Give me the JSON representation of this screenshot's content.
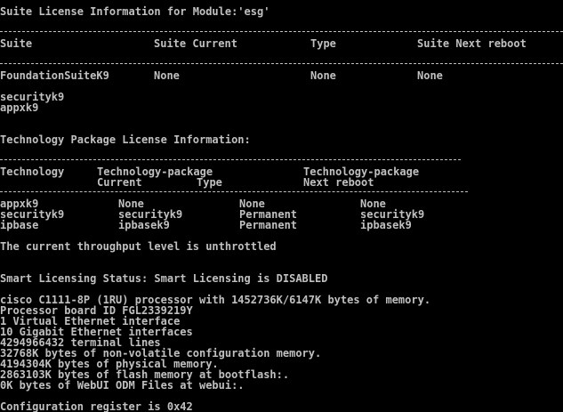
{
  "terminal": {
    "colors": {
      "background": "#000000",
      "text": "#c0c0c0"
    },
    "suite_section": {
      "title": "Suite License Information for Module:'esg'",
      "headers": [
        "Suite",
        "Suite Current",
        "Type",
        "Suite Next reboot"
      ],
      "row": [
        "FoundationSuiteK9",
        "None",
        "None",
        "None"
      ],
      "sub_items": [
        "securityk9",
        "appxk9"
      ]
    },
    "tech_section": {
      "title": "Technology Package License Information:",
      "header_row1": [
        "Technology",
        "Technology-package",
        "Technology-package"
      ],
      "header_row2": [
        "Current",
        "Type",
        "Next reboot"
      ],
      "rows": [
        [
          "appxk9",
          "None",
          "None",
          "None"
        ],
        [
          "securityk9",
          "securityk9",
          "Permanent",
          "securityk9"
        ],
        [
          "ipbase",
          "ipbasek9",
          "Permanent",
          "ipbasek9"
        ]
      ]
    },
    "throughput_line": "The current throughput level is unthrottled",
    "smart_licensing_line": "Smart Licensing Status: Smart Licensing is DISABLED",
    "system_lines": [
      "cisco C1111-8P (1RU) processor with 1452736K/6147K bytes of memory.",
      "Processor board ID FGL2339219Y",
      "1 Virtual Ethernet interface",
      "10 Gigabit Ethernet interfaces",
      "4294966432 terminal lines",
      "32768K bytes of non-volatile configuration memory.",
      "4194304K bytes of physical memory.",
      "2863103K bytes of flash memory at bootflash:.",
      "0K bytes of WebUI ODM Files at webui:."
    ],
    "config_register_line": "Configuration register is 0x42"
  }
}
